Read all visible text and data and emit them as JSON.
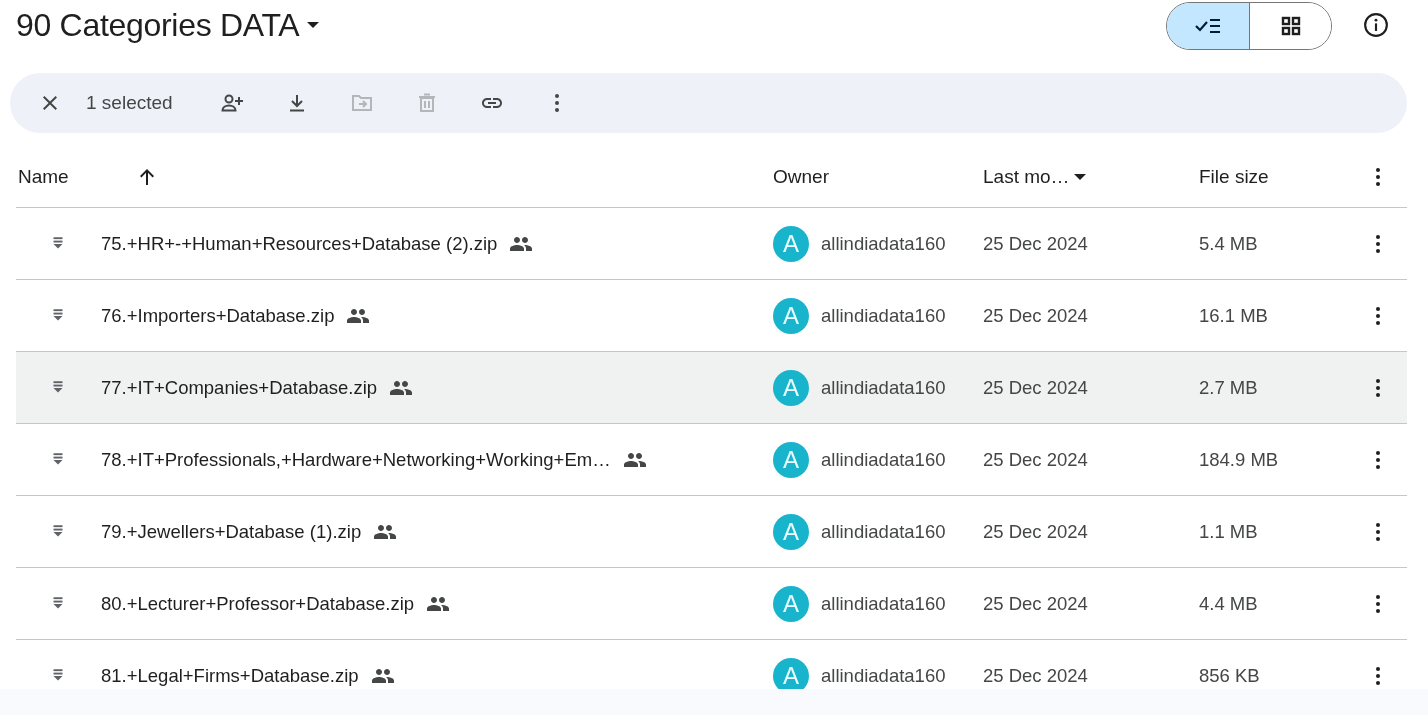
{
  "folder": {
    "title": "90 Categories DATA"
  },
  "view_toggle": [
    {
      "kind": "list",
      "selected": true
    },
    {
      "kind": "grid",
      "selected": false
    }
  ],
  "selection_bar": {
    "count_label": "1 selected",
    "actions": [
      {
        "kind": "share",
        "disabled": false
      },
      {
        "kind": "download",
        "disabled": false
      },
      {
        "kind": "move",
        "disabled": true
      },
      {
        "kind": "delete",
        "disabled": true
      },
      {
        "kind": "link",
        "disabled": false
      },
      {
        "kind": "more",
        "disabled": false
      }
    ]
  },
  "table": {
    "columns": [
      {
        "label": "Name",
        "sorted": true,
        "menu": false
      },
      {
        "label": "Owner",
        "sorted": false,
        "menu": false
      },
      {
        "label": "Last mo…",
        "sorted": false,
        "menu": true
      },
      {
        "label": "File size",
        "sorted": false,
        "menu": false
      }
    ],
    "rows": [
      {
        "name": "75.+HR+-+Human+Resources+Database (2).zip",
        "shared": true,
        "owner_initial": "A",
        "owner": "allindiadata160",
        "modified": "25 Dec 2024",
        "size": "5.4 MB",
        "highlighted": false
      },
      {
        "name": "76.+Importers+Database.zip",
        "shared": true,
        "owner_initial": "A",
        "owner": "allindiadata160",
        "modified": "25 Dec 2024",
        "size": "16.1 MB",
        "highlighted": false
      },
      {
        "name": "77.+IT+Companies+Database.zip",
        "shared": true,
        "owner_initial": "A",
        "owner": "allindiadata160",
        "modified": "25 Dec 2024",
        "size": "2.7 MB",
        "highlighted": true
      },
      {
        "name": "78.+IT+Professionals,+Hardware+Networking+Working+Em…",
        "shared": true,
        "owner_initial": "A",
        "owner": "allindiadata160",
        "modified": "25 Dec 2024",
        "size": "184.9 MB",
        "highlighted": false
      },
      {
        "name": "79.+Jewellers+Database (1).zip",
        "shared": true,
        "owner_initial": "A",
        "owner": "allindiadata160",
        "modified": "25 Dec 2024",
        "size": "1.1 MB",
        "highlighted": false
      },
      {
        "name": "80.+Lecturer+Professor+Database.zip",
        "shared": true,
        "owner_initial": "A",
        "owner": "allindiadata160",
        "modified": "25 Dec 2024",
        "size": "4.4 MB",
        "highlighted": false
      },
      {
        "name": "81.+Legal+Firms+Database.zip",
        "shared": true,
        "owner_initial": "A",
        "owner": "allindiadata160",
        "modified": "25 Dec 2024",
        "size": "856 KB",
        "highlighted": false
      }
    ]
  }
}
